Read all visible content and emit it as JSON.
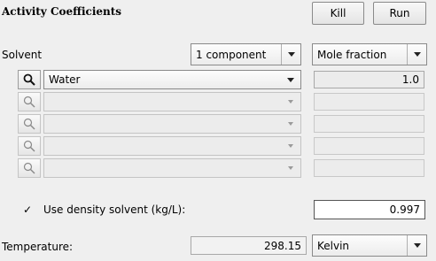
{
  "header": {
    "title": "Activity Coefficients",
    "kill_label": "Kill",
    "run_label": "Run"
  },
  "solvent": {
    "label": "Solvent",
    "components_value": "1 component",
    "fraction_value": "Mole fraction"
  },
  "components": [
    {
      "name": "Water",
      "value": "1.0",
      "enabled": true
    },
    {
      "name": "",
      "value": "",
      "enabled": false
    },
    {
      "name": "",
      "value": "",
      "enabled": false
    },
    {
      "name": "",
      "value": "",
      "enabled": false
    },
    {
      "name": "",
      "value": "",
      "enabled": false
    }
  ],
  "density": {
    "checkbox_checked": true,
    "check_glyph": "✓",
    "label": "Use density solvent (kg/L):",
    "value": "0.997"
  },
  "temperature": {
    "label": "Temperature:",
    "value": "298.15",
    "unit": "Kelvin"
  },
  "icons": {
    "search": "magnifier-icon",
    "dropdown": "chevron-down-icon"
  }
}
